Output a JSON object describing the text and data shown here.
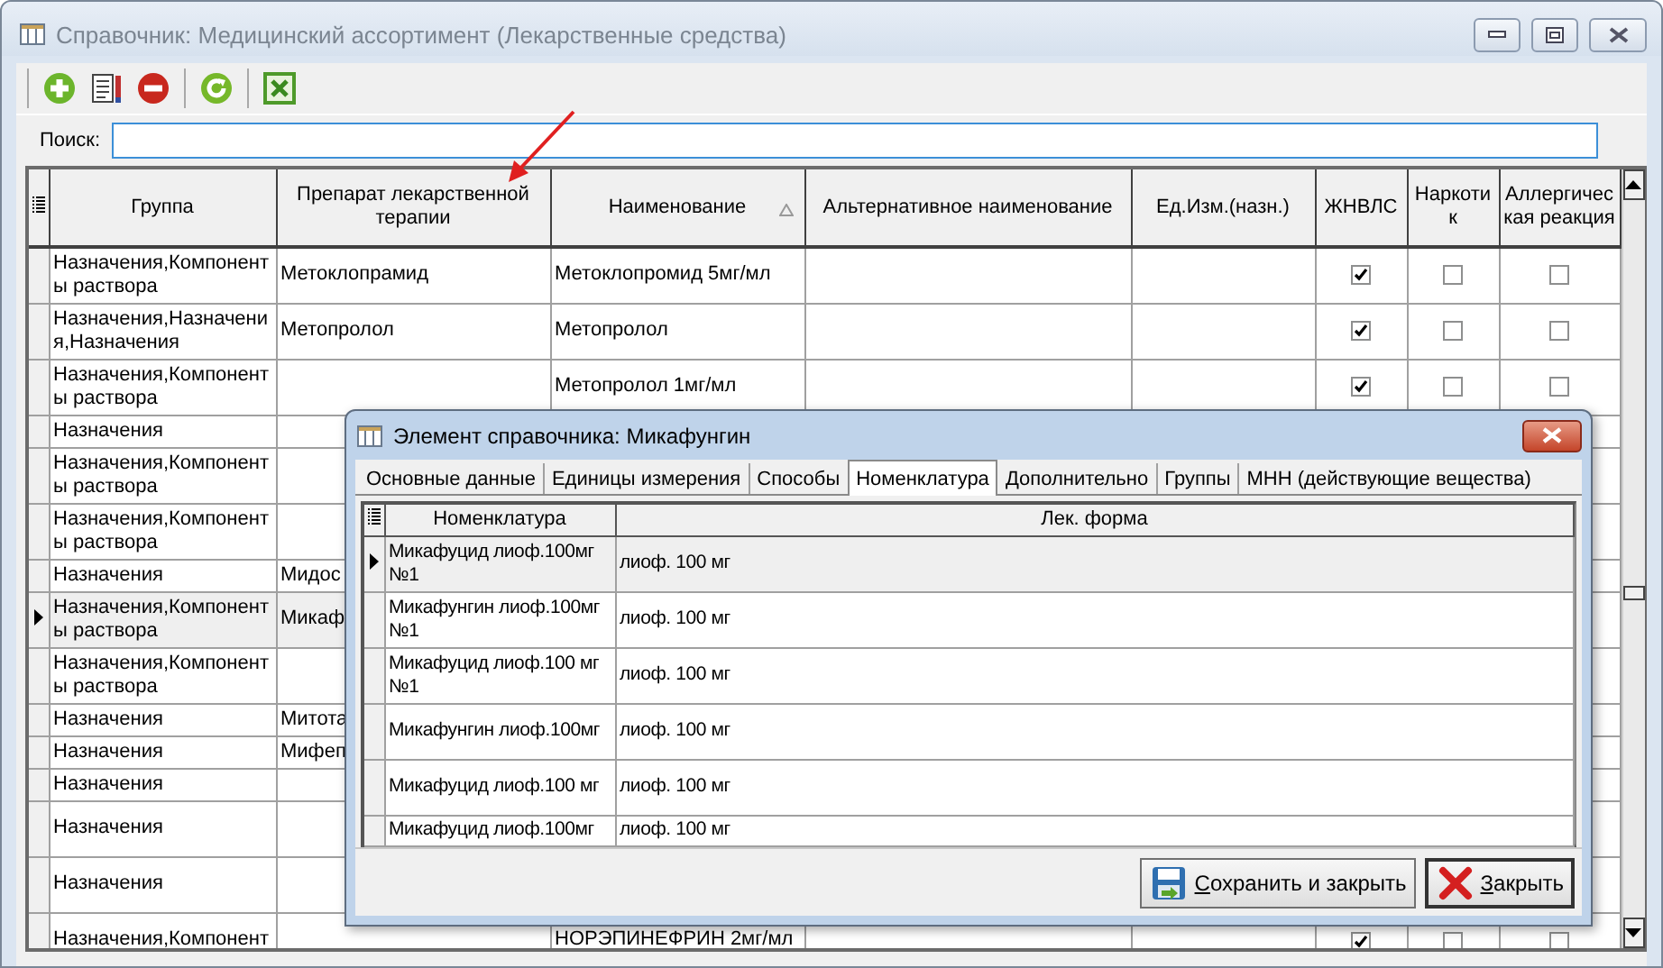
{
  "window": {
    "title": "Справочник: Медицинский ассортимент (Лекарственные средства)"
  },
  "search": {
    "label": "Поиск:"
  },
  "table": {
    "columns": [
      {
        "label": "Группа"
      },
      {
        "label": "Препарат лекарственной терапии"
      },
      {
        "label": "Наименование",
        "sorted": true
      },
      {
        "label": "Альтернативное наименование"
      },
      {
        "label": "Ед.Изм.(назн.)"
      },
      {
        "label": "ЖНВЛС"
      },
      {
        "label": "Наркотик"
      },
      {
        "label": "Аллергическая реакция"
      }
    ],
    "rows": [
      {
        "selected": false,
        "group": "Назначения,Компоненты раствора",
        "drug": "Метоклопрамид",
        "name": "Метоклопромид 5мг/мл",
        "flags": [
          true,
          false,
          false
        ]
      },
      {
        "selected": false,
        "group": "Назначения,Назначения,Назначения",
        "drug": "Метопролол",
        "name": "Метопролол",
        "flags": [
          true,
          false,
          false
        ]
      },
      {
        "selected": false,
        "group": "Назначения,Компоненты раствора",
        "name": "Метопролол 1мг/мл",
        "flags": [
          true,
          false,
          false
        ]
      },
      {
        "selected": false,
        "group": "Назначения"
      },
      {
        "selected": false,
        "group": "Назначения,Компоненты раствора"
      },
      {
        "selected": false,
        "group": "Назначения,Компоненты раствора"
      },
      {
        "selected": false,
        "group": "Назначения",
        "drug": "Мидос"
      },
      {
        "selected": true,
        "group": "Назначения,Компоненты раствора",
        "drug": "Микаф"
      },
      {
        "selected": false,
        "group": "Назначения,Компоненты раствора"
      },
      {
        "selected": false,
        "group": "Назначения",
        "drug": "Митота"
      },
      {
        "selected": false,
        "group": "Назначения",
        "drug": "Мифеп"
      },
      {
        "selected": false,
        "group": "Назначения"
      },
      {
        "selected": false,
        "group": "Назначения"
      },
      {
        "selected": false,
        "group": "Назначения"
      },
      {
        "selected": false,
        "group": "Назначения,Компонент",
        "name": "НОРЭПИНЕФРИН 2мг/мл",
        "flags": [
          true,
          false,
          false
        ]
      }
    ]
  },
  "dialog": {
    "title": "Элемент справочника: Микафунгин",
    "tabs": [
      {
        "label": "Основные данные",
        "selected": false
      },
      {
        "label": "Единицы измерения",
        "selected": false
      },
      {
        "label": "Способы",
        "selected": false
      },
      {
        "label": "Номенклатура",
        "selected": true
      },
      {
        "label": "Дополнительно",
        "selected": false
      },
      {
        "label": "Группы",
        "selected": false
      },
      {
        "label": "МНН (действующие вещества)",
        "selected": false
      }
    ],
    "grid": {
      "columns": [
        "Номенклатура",
        "Лек. форма"
      ],
      "rows": [
        {
          "selected": true,
          "nomenclature": "Микафуцид лиоф.100мг №1",
          "form": "лиоф. 100 мг"
        },
        {
          "selected": false,
          "nomenclature": "Микафунгин лиоф.100мг №1",
          "form": "лиоф. 100 мг"
        },
        {
          "selected": false,
          "nomenclature": "Микафуцид лиоф.100 мг №1",
          "form": "лиоф. 100 мг"
        },
        {
          "selected": false,
          "nomenclature": "Микафунгин лиоф.100мг",
          "form": "лиоф. 100 мг"
        },
        {
          "selected": false,
          "nomenclature": "Микафуцид лиоф.100 мг",
          "form": "лиоф. 100 мг"
        },
        {
          "selected": false,
          "nomenclature": "Микафуцид лиоф.100мг",
          "form": "лиоф. 100 мг"
        }
      ]
    },
    "buttons": [
      {
        "kind": "save",
        "label": "Сохранить и закрыть",
        "default": false
      },
      {
        "kind": "close",
        "label": "Закрыть",
        "default": true
      }
    ]
  }
}
